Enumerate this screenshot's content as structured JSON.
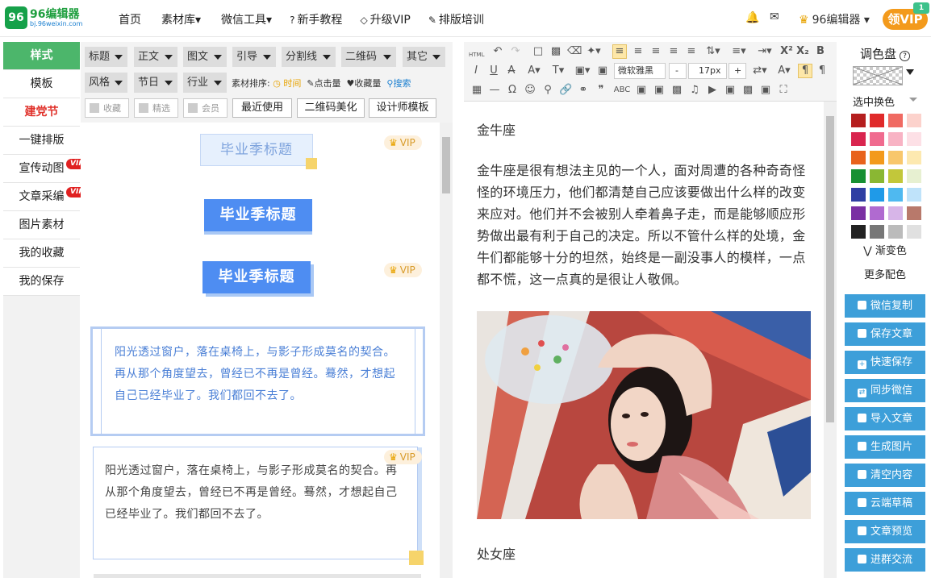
{
  "logo": {
    "name": "96编辑器",
    "url": "bj.96weixin.com",
    "mark": "96"
  },
  "nav": [
    {
      "icon": "",
      "label": "首页"
    },
    {
      "icon": "",
      "label": "素材库▾"
    },
    {
      "icon": "",
      "label": "微信工具▾"
    },
    {
      "icon": "?",
      "label": "新手教程"
    },
    {
      "icon": "◇",
      "label": "升级VIP"
    },
    {
      "icon": "✎",
      "label": "排版培训"
    }
  ],
  "user": {
    "name": "96编辑器 ▾",
    "vip_button": "领VIP",
    "vip_tag": "1"
  },
  "left_tabs": [
    {
      "label": "样式",
      "style": "active"
    },
    {
      "label": "模板",
      "style": ""
    },
    {
      "label": "建党节",
      "style": "red"
    },
    {
      "label": "一键排版",
      "style": ""
    },
    {
      "label": "宣传动图",
      "style": "",
      "vip": "VIP"
    },
    {
      "label": "文章采编",
      "style": "",
      "vip": "VIP"
    },
    {
      "label": "图片素材",
      "style": ""
    },
    {
      "label": "我的收藏",
      "style": ""
    },
    {
      "label": "我的保存",
      "style": ""
    }
  ],
  "filters": {
    "row1": [
      "标题",
      "正文",
      "图文",
      "引导",
      "分割线",
      "二维码",
      "其它"
    ],
    "row2": [
      "风格",
      "节日",
      "行业"
    ],
    "sort_label": "素材排序:",
    "sort_time": "◷ 时间",
    "sort_clicks": "点击量",
    "sort_fav": "收藏量",
    "sort_search": "搜索",
    "checks": [
      "收藏",
      "精选",
      "会员"
    ],
    "buttons": [
      "最近使用",
      "二维码美化",
      "设计师模板"
    ]
  },
  "materials": {
    "vip_label": "VIP",
    "title_text": "毕业季标题",
    "paragraph": "阳光透过窗户，落在桌椅上，与影子形成莫名的契合。再从那个角度望去，曾经已不再是曾经。蓦然，才想起自己已经毕业了。我们都回不去了。"
  },
  "toolbar": {
    "html": "HTML",
    "font": "微软雅黑",
    "size": "17px",
    "minus": "-",
    "plus": "+"
  },
  "doc": {
    "heading1": "金牛座",
    "body": "金牛座是很有想法主见的一个人，面对周遭的各种奇奇怪怪的环境压力，他们都清楚自己应该要做出什么样的改变来应对。他们并不会被别人牵着鼻子走，而是能够顺应形势做出最有利于自己的决定。所以不管什么样的处境，金牛们都能够十分的坦然，始终是一副没事人的模样，一点都不慌，这一点真的是很让人敬佩。",
    "heading2": "处女座",
    "image_alt": "girl-photo"
  },
  "palette": {
    "title": "调色盘",
    "replace": "选中换色",
    "gradient": "渐变色",
    "more": "更多配色",
    "colors": [
      [
        "#b51e1e",
        "#e02a2a",
        "#f06a62",
        "#fcd2cc"
      ],
      [
        "#d9254f",
        "#f06b8f",
        "#f8b3c4",
        "#fde0e6"
      ],
      [
        "#e8621c",
        "#f39a1c",
        "#f8c76c",
        "#fde9b0"
      ],
      [
        "#179033",
        "#8ab733",
        "#c2c73a",
        "#e7f0d1"
      ],
      [
        "#2f3ea3",
        "#1f9ae8",
        "#4fb9f0",
        "#bfe3fa"
      ],
      [
        "#7a2fa3",
        "#b06ad0",
        "#d7b5e8",
        "#b8796b"
      ],
      [
        "#222222",
        "#777777",
        "#bbbbbb",
        "#e0e0e0"
      ]
    ]
  },
  "actions": [
    "微信复制",
    "保存文章",
    "快速保存",
    "同步微信",
    "导入文章",
    "生成图片",
    "清空内容",
    "云端草稿",
    "文章预览",
    "进群交流"
  ]
}
